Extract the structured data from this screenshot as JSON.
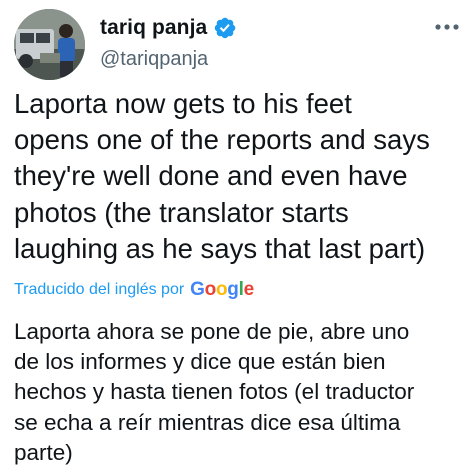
{
  "tweet": {
    "author": {
      "display_name": "tariq panja",
      "handle": "@tariqpanja",
      "verified": true,
      "avatar_icon": "profile-photo"
    },
    "text": "Laporta now gets to his feet\nopens one of the reports and says\nthey're well done and even have\nphotos (the translator starts\nlaughing as he says that last part)",
    "translation": {
      "credit_label": "Traducido del inglés por",
      "provider": {
        "letters": [
          "G",
          "o",
          "o",
          "g",
          "l",
          "e"
        ],
        "colors": [
          "#4285f4",
          "#ea4335",
          "#fbbc05",
          "#4285f4",
          "#34a853",
          "#ea4335"
        ]
      },
      "text": "Laporta ahora se pone de pie, abre uno\nde los informes y dice que están bien\nhechos y hasta tienen fotos (el traductor\nse echa a reír mientras dice esa última\nparte)"
    }
  },
  "colors": {
    "accent": "#1d9bf0",
    "text": "#0f1419",
    "secondary_text": "#536471"
  },
  "icons": {
    "verified": "verified-badge-icon",
    "more": "more-options-icon"
  }
}
